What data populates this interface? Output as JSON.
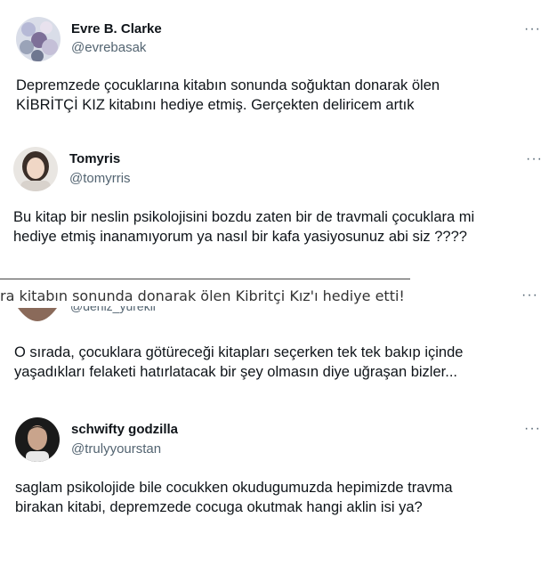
{
  "tweets": [
    {
      "name": "Evre B. Clarke",
      "handle": "@evrebasak",
      "avatar_icon": "avatar-flowers-icon",
      "text": "Depremzede çocuklarına kitabın sonunda soğuktan donarak ölen\nKİBRİTÇİ KIZ kitabını hediye etmiş. Gerçekten deliricem artık"
    },
    {
      "name": "Tomyris",
      "handle": "@tomyrris",
      "avatar_icon": "avatar-person-icon",
      "text": "Bu kitap bir neslin psikolojisini bozdu zaten bir de travmali çocuklara mi\nhediye etmiş inanamıyorum ya nasıl bir kafa yasiyosunuz abi siz ????"
    },
    {
      "name": "",
      "handle": "@deniz_yurekli",
      "avatar_icon": "avatar-person-icon",
      "text": "O sırada, çocuklara götüreceği kitapları seçerken tek tek bakıp içinde\nyaşadıkları felaketi hatırlatacak bir şey olmasın diye uğraşan bizler..."
    },
    {
      "name": "schwifty godzilla",
      "handle": "@trulyyourstan",
      "avatar_icon": "avatar-person-icon",
      "text": "saglam psikolojide bile cocukken okudugumuzda hepimizde travma\nbirakan kitabi, depremzede cocuga okutmak hangi aklin isi ya?"
    }
  ],
  "more_label": "···",
  "overlay_caption": "ra kitabın sonunda donarak ölen Kibritçi Kız'ı hediye etti!"
}
